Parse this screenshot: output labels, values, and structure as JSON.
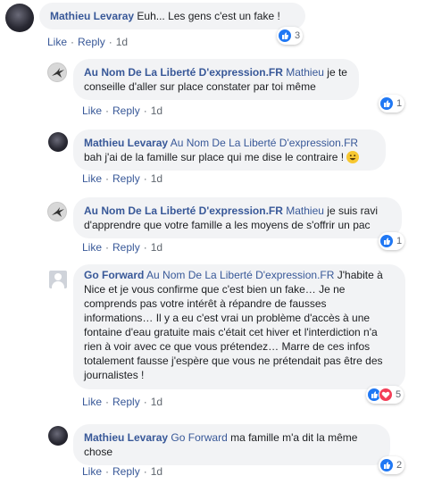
{
  "actions": {
    "like": "Like",
    "reply": "Reply"
  },
  "comments": [
    {
      "author": "Mathieu Levaray",
      "mention": "",
      "text": "Euh... Les gens c'est un fake !",
      "time": "1d",
      "reactions": "3",
      "avatar": "dark"
    },
    {
      "author": "Au Nom De La Liberté D'expression.FR",
      "mention": "Mathieu",
      "text": "je te conseille d'aller sur place constater par toi même",
      "time": "1d",
      "reactions": "1",
      "avatar": "bird"
    },
    {
      "author": "Mathieu Levaray",
      "mention": "Au Nom De La Liberté D'expression.FR",
      "text": "bah j'ai de la famille sur place qui me dise le contraire !",
      "emoji": "grinning-face-emoji",
      "time": "1d",
      "reactions": "",
      "avatar": "dark"
    },
    {
      "author": "Au Nom De La Liberté D'expression.FR",
      "mention": "Mathieu",
      "text": "je suis ravi d'apprendre que votre famille a les moyens de s'offrir un pac",
      "time": "1d",
      "reactions": "1",
      "avatar": "bird"
    },
    {
      "author": "Go Forward",
      "mention": "Au Nom De La Liberté D'expression.FR",
      "text": "J'habite à Nice et je vous confirme que c'est bien un fake… Je ne comprends pas votre intérêt à répandre de fausses informations… Il y a eu c'est vrai un problème d'accès à une fontaine d'eau gratuite mais c'était cet hiver et l'interdiction n'a rien à voir avec ce que vous prétendez… Marre de ces infos totalement fausse j'espère que vous ne prétendait pas être des journalistes !",
      "time": "1d",
      "reactions": "5",
      "avatar": "generic"
    },
    {
      "author": "Mathieu Levaray",
      "mention": "Go Forward",
      "text": "ma famille m'a dit la même chose",
      "time": "1d",
      "reactions": "2",
      "avatar": "dark"
    }
  ],
  "colors": {
    "link": "#385898",
    "bubble": "#f2f3f5",
    "like": "#2078f4",
    "love": "#f33e58"
  }
}
